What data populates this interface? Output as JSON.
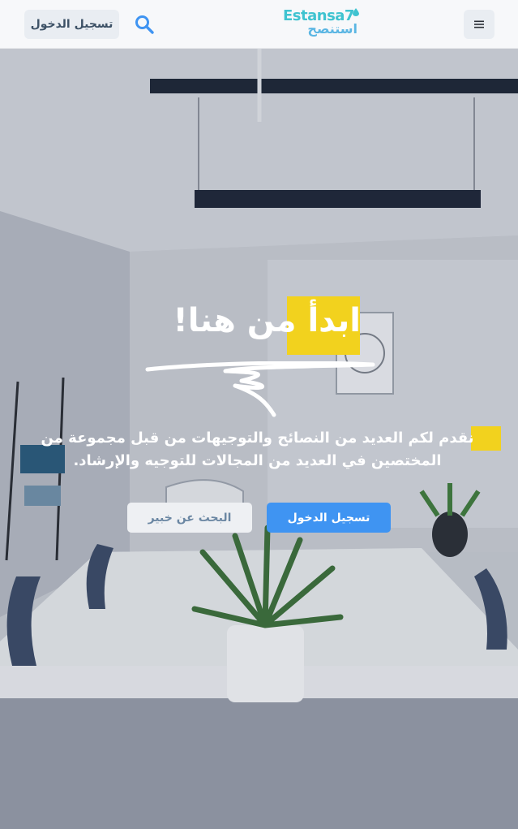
{
  "header": {
    "login_label": "تسجيل الدخول",
    "logo_en": "Estansa7",
    "logo_ar": "استنصح",
    "search_icon": "search-icon",
    "menu_icon": "hamburger-menu-icon"
  },
  "hero": {
    "title": "ابدأ من هنا!",
    "description": "نقدم لكم العديد من النصائح والتوجيهات من قبل مجموعة من المختصين في العديد من المجالات للتوجيه والإرشاد.",
    "primary_button": "تسجيل الدخول",
    "secondary_button": "البحث عن خبير"
  },
  "colors": {
    "accent_yellow": "#f2d21e",
    "primary_blue": "#3f94f2",
    "logo_teal": "#3fc3d0"
  }
}
